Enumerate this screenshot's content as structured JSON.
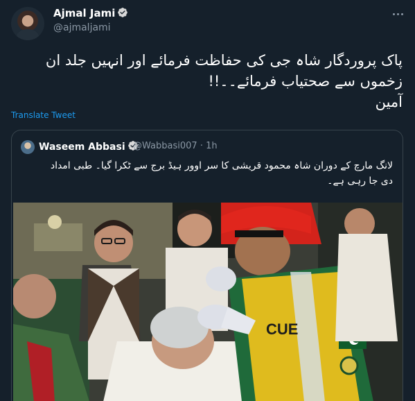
{
  "author": {
    "name": "Ajmal Jami",
    "handle": "@ajmaljami"
  },
  "tweet": {
    "lines": [
      "پاک پروردگار شاہ جی کی حفاظت فرمائے اور انہیں جلد ان",
      "زخموں سے صحتیاب فرمائے۔۔!!",
      "آمین"
    ],
    "translate_label": "Translate Tweet"
  },
  "quoted": {
    "name": "Waseem Abbasi",
    "handle": "@Wabbasi007",
    "time": "1h",
    "lines": [
      "لانگ مارچ کے دوران شاہ محمود قریشی کا سر اوور ہیڈ برج سے ٹکرا گیا۔ طبی امداد",
      "دی جا رہی ہے۔"
    ],
    "media": {
      "description_colors": {
        "rescue_vest": "#f0c21c",
        "helmet": "#e0261d",
        "uniform": "#1f6a3a"
      },
      "vest_text": "CUE"
    }
  },
  "colors": {
    "background": "#15202b",
    "text": "#ffffff",
    "secondary": "#8b98a5",
    "accent": "#1d9bf0",
    "border": "#38444d"
  },
  "icons": [
    "verified-badge-icon",
    "more-options-icon"
  ]
}
